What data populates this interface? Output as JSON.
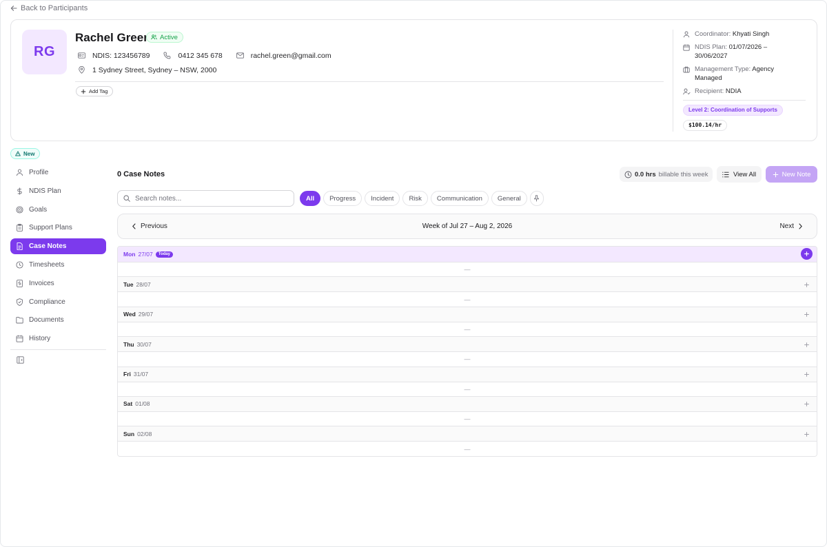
{
  "back_link": "Back to Participants",
  "participant": {
    "initials": "RG",
    "name": "Rachel Green",
    "status": "Active",
    "ndis": "NDIS: 123456789",
    "phone": "0412 345 678",
    "email": "rachel.green@gmail.com",
    "address": "1 Sydney Street, Sydney – NSW, 2000",
    "add_tag": "Add Tag"
  },
  "details": {
    "coordinator_label": "Coordinator:",
    "coordinator": "Khyati Singh",
    "plan_label": "NDIS Plan:",
    "plan": "01/07/2026 – 30/06/2027",
    "management_label": "Management Type:",
    "management": "Agency Managed",
    "recipient_label": "Recipient:",
    "recipient": "NDIA",
    "level": "Level 2: Coordination of Supports",
    "rate": "$100.14/hr"
  },
  "new_badge": "New",
  "sidebar": {
    "items": [
      {
        "label": "Profile",
        "icon": "user-icon"
      },
      {
        "label": "NDIS Plan",
        "icon": "dollar-icon"
      },
      {
        "label": "Goals",
        "icon": "target-icon"
      },
      {
        "label": "Support Plans",
        "icon": "clipboard-icon"
      },
      {
        "label": "Case Notes",
        "icon": "note-icon"
      },
      {
        "label": "Timesheets",
        "icon": "clock-icon"
      },
      {
        "label": "Invoices",
        "icon": "invoice-icon"
      },
      {
        "label": "Compliance",
        "icon": "shield-icon"
      },
      {
        "label": "Documents",
        "icon": "folder-icon"
      },
      {
        "label": "History",
        "icon": "calendar-icon"
      }
    ],
    "active": "Case Notes"
  },
  "main": {
    "title": "0 Case Notes",
    "billable_value": "0.0 hrs",
    "billable_suffix": "billable this week",
    "view_all": "View All",
    "new_note": "New Note",
    "search_placeholder": "Search notes...",
    "filters": [
      "All",
      "Progress",
      "Incident",
      "Risk",
      "Communication",
      "General"
    ],
    "active_filter": "All"
  },
  "week": {
    "prev": "Previous",
    "label": "Week of Jul 27 – Aug 2, 2026",
    "next": "Next"
  },
  "days": [
    {
      "name": "Mon",
      "date": "27/07",
      "today": true,
      "today_label": "Today",
      "empty": "—"
    },
    {
      "name": "Tue",
      "date": "28/07",
      "empty": "—"
    },
    {
      "name": "Wed",
      "date": "29/07",
      "empty": "—"
    },
    {
      "name": "Thu",
      "date": "30/07",
      "empty": "—"
    },
    {
      "name": "Fri",
      "date": "31/07",
      "empty": "—"
    },
    {
      "name": "Sat",
      "date": "01/08",
      "empty": "—"
    },
    {
      "name": "Sun",
      "date": "02/08",
      "empty": "—"
    }
  ],
  "colors": {
    "accent": "#7c3aed",
    "accent_light": "#f3e8ff",
    "active_green": "#16a34a",
    "new_teal": "#0f766e"
  }
}
